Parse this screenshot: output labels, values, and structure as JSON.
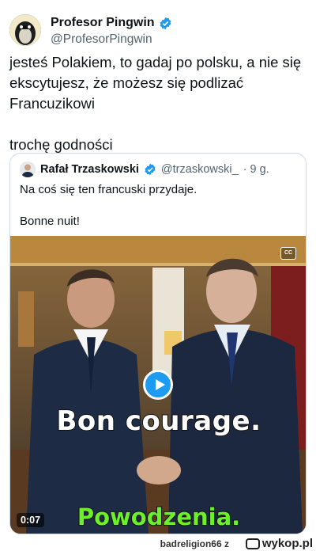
{
  "author": {
    "display_name": "Profesor Pingwin",
    "handle": "@ProfesorPingwin"
  },
  "tweet": {
    "text": "jesteś Polakiem, to gadaj po polsku, a nie się ekscytujesz, że możesz się podlizać Francuzikowi\n\ntrochę godności"
  },
  "quoted_tweet": {
    "display_name": "Rafał Trzaskowski",
    "handle": "@trzaskowski_",
    "time": "· 9 g.",
    "text": "Na coś się ten francuski przydaje.\n\nBonne nuit!",
    "video": {
      "cc_label": "CC",
      "subtitle_fr": "Bon courage.",
      "subtitle_pl": "Powodzenia.",
      "duration": "0:07"
    }
  },
  "watermark": {
    "user": "badreligion66",
    "sep": "z",
    "site": "wykop.pl"
  },
  "colors": {
    "verified": "#1d9bf0",
    "text": "#0f1419",
    "muted": "#536471",
    "subtitle_green": "#6cf02a"
  }
}
